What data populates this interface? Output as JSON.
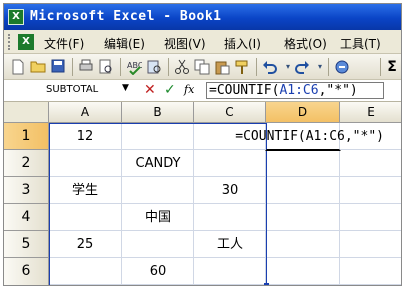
{
  "window": {
    "title": "Microsoft Excel - Book1",
    "app_icon": "X"
  },
  "menu": {
    "items": [
      "文件(F)",
      "编辑(E)",
      "视图(V)",
      "插入(I)",
      "格式(O)",
      "工具(T)"
    ]
  },
  "toolbar": {
    "icons": [
      "new-icon",
      "open-icon",
      "save-icon",
      "print-icon",
      "print-preview-icon",
      "spellcheck-icon",
      "research-icon",
      "cut-icon",
      "copy-icon",
      "paste-icon",
      "format-painter-icon",
      "undo-icon",
      "redo-icon",
      "autosum-icon"
    ],
    "autosum_glyph": "Σ"
  },
  "formula_bar": {
    "name_box": "SUBTOTAL",
    "cancel": "✕",
    "enter": "✓",
    "fx": "fx",
    "formula_prefix": "=COUNTIF(",
    "formula_ref": "A1:C6",
    "formula_suffix": ",\"*\")"
  },
  "sheet": {
    "columns": [
      "A",
      "B",
      "C",
      "D",
      "E"
    ],
    "active_column": "D",
    "rows": [
      "1",
      "2",
      "3",
      "4",
      "5",
      "6"
    ],
    "active_row": "1",
    "cells": {
      "A1": "12",
      "B2": "CANDY",
      "A3": "学生",
      "C3": "30",
      "B4": "中国",
      "A5": "25",
      "C5": "工人",
      "B6": "60",
      "D1_overflow": "=COUNTIF(A1:C6,\"*\")"
    }
  }
}
